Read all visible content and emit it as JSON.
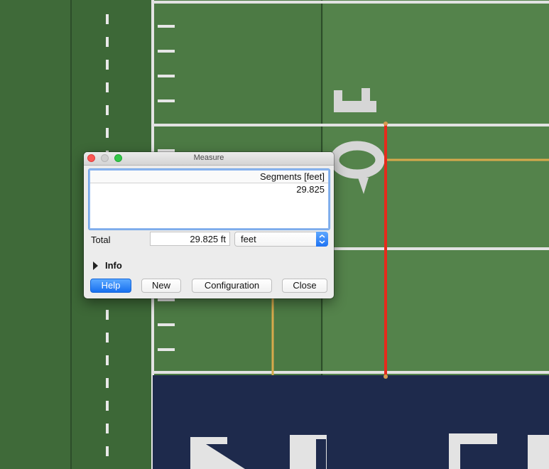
{
  "window": {
    "title": "Measure"
  },
  "segments": {
    "header": "Segments [feet]",
    "rows": [
      "29.825"
    ]
  },
  "total": {
    "label": "Total",
    "value": "29.825 ft",
    "unit": "feet"
  },
  "info": {
    "label": "Info",
    "expanded": false
  },
  "buttons": {
    "help": "Help",
    "new": "New",
    "configuration": "Configuration",
    "close": "Close"
  },
  "field_marking": "10",
  "colors": {
    "turf": "#4f7a45",
    "endzone": "#1e2a4c",
    "measure_line": "#e62a1c",
    "accent": "#1870f0"
  }
}
